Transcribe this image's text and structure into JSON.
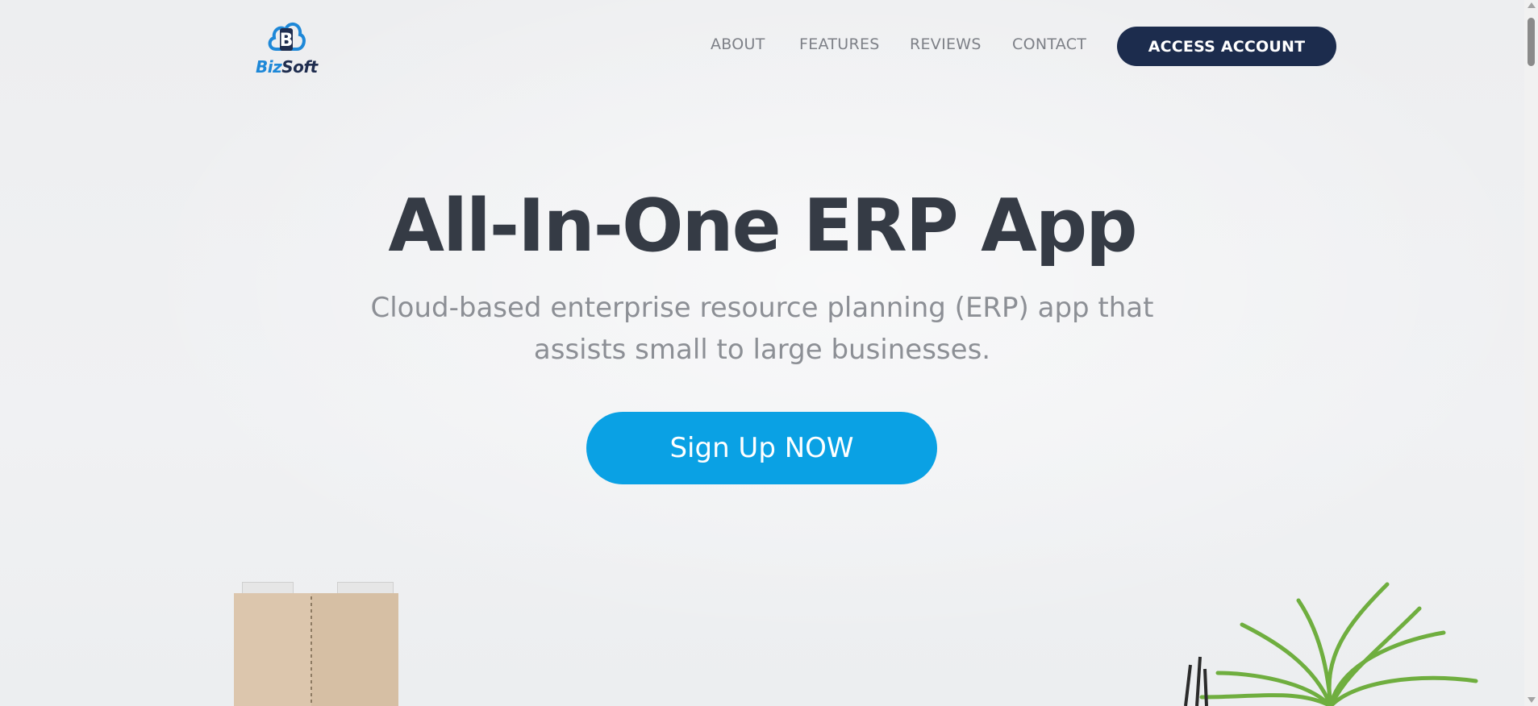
{
  "brand": {
    "name_part1": "Biz",
    "name_part2": "Soft",
    "logo_icon": "cloud-b-logo-icon",
    "colors": {
      "primary_dark": "#1c2c4d",
      "accent_blue": "#0aa1e4",
      "logo_blue": "#1e88d8"
    }
  },
  "nav": {
    "items": [
      {
        "label": "ABOUT"
      },
      {
        "label": "FEATURES"
      },
      {
        "label": "REVIEWS"
      },
      {
        "label": "CONTACT"
      }
    ],
    "cta_label": "ACCESS ACCOUNT"
  },
  "hero": {
    "title": "All-In-One ERP App",
    "subtitle": "Cloud-based enterprise resource planning (ERP) app that assists small to large businesses.",
    "cta_label": "Sign Up NOW"
  }
}
